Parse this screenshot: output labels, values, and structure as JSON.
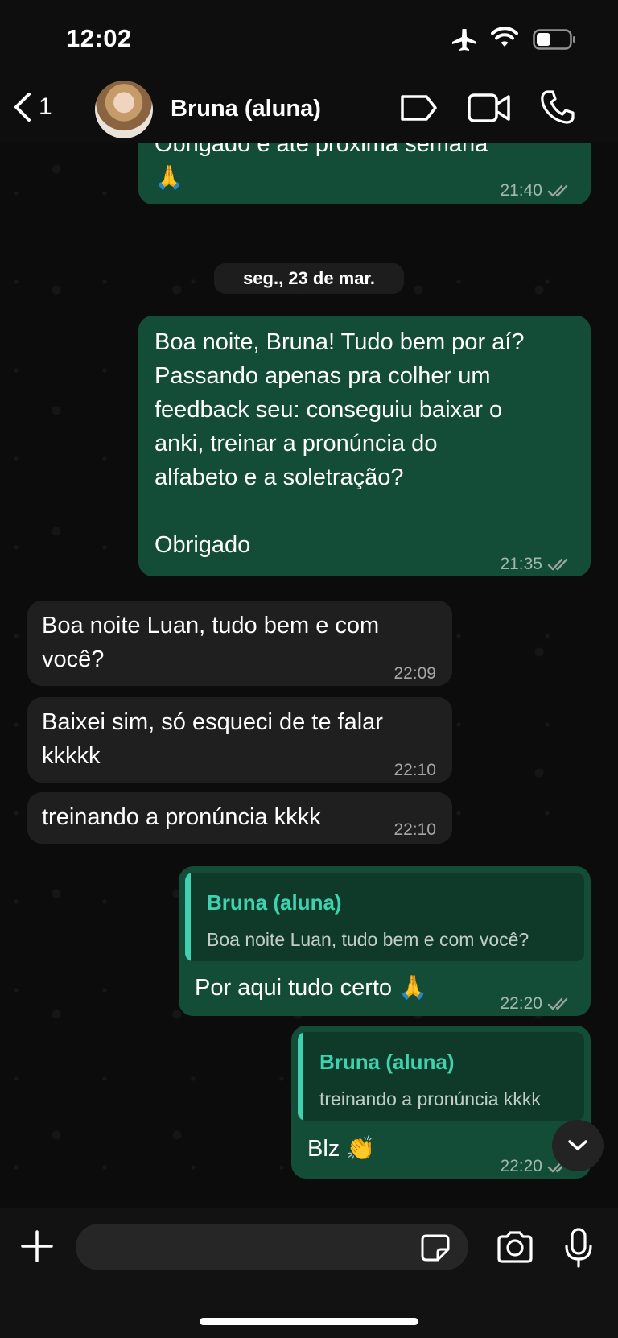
{
  "status_bar": {
    "time": "12:02"
  },
  "header": {
    "back_count": "1",
    "contact_name": "Bruna (aluna)"
  },
  "messages": [
    {
      "type": "out",
      "text": "Obrigado e até próxima semana\n🙏",
      "time": "21:40"
    },
    {
      "type": "date",
      "text": "seg., 23 de mar."
    },
    {
      "type": "out",
      "text": "Boa noite, Bruna! Tudo bem por aí?\nPassando apenas pra colher um\nfeedback seu: conseguiu baixar o\nanki, treinar a pronúncia do\nalfabeto e a soletração?\n\nObrigado",
      "time": "21:35"
    },
    {
      "type": "in",
      "text": "Boa noite Luan, tudo bem e com\nvocê?",
      "time": "22:09"
    },
    {
      "type": "in",
      "text": "Baixei sim, só esqueci de te falar\nkkkkk",
      "time": "22:10"
    },
    {
      "type": "in",
      "text": "treinando a pronúncia kkkk",
      "time": "22:10"
    },
    {
      "type": "out-reply",
      "quote_name": "Bruna (aluna)",
      "quote_text": "Boa noite Luan, tudo bem e com você?",
      "text": "Por aqui tudo certo 🙏",
      "time": "22:20"
    },
    {
      "type": "out-reply",
      "quote_name": "Bruna (aluna)",
      "quote_text": "treinando a pronúncia kkkk",
      "text": "Blz 👏",
      "time": "22:20"
    }
  ],
  "input": {
    "placeholder": ""
  },
  "colors": {
    "outgoing_bubble": "#144d37",
    "incoming_bubble": "#1f1f1f",
    "quote_accent": "#3fd1b0",
    "read_ticks": "#9aa59f"
  },
  "icons": [
    "airplane-icon",
    "wifi-icon",
    "battery-icon",
    "back-chevron-icon",
    "label-icon",
    "video-call-icon",
    "voice-call-icon",
    "double-check-icon",
    "chevron-down-icon",
    "plus-icon",
    "sticker-icon",
    "camera-icon",
    "mic-icon"
  ]
}
